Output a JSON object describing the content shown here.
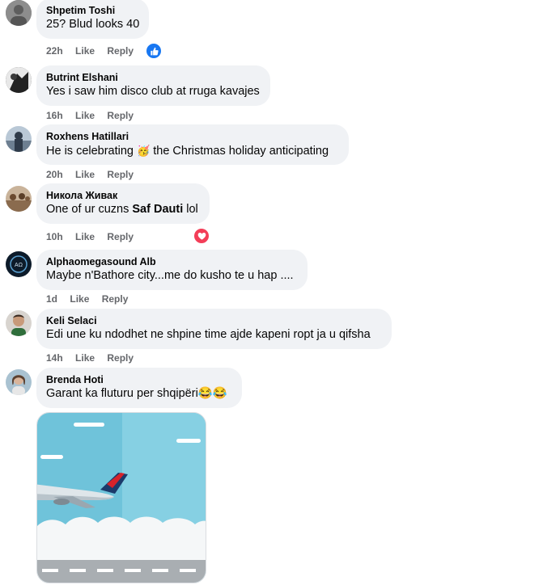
{
  "comments": [
    {
      "author": "Shpetim Toshi",
      "text": "25? Blud looks 40",
      "time": "22h",
      "like": "Like",
      "reply": "Reply",
      "reaction": "like-icon",
      "avatar_color": "#7a7a7a"
    },
    {
      "author": "Butrint Elshani",
      "text": "Yes i saw him disco club at rruga kavajes",
      "time": "16h",
      "like": "Like",
      "reply": "Reply",
      "avatar_color": "#2d2d2d"
    },
    {
      "author": "Roxhens Hatillari",
      "text_before": "He is celebrating",
      "emoji": "🥳",
      "text_after": "the Christmas holiday anticipating",
      "time": "20h",
      "like": "Like",
      "reply": "Reply",
      "avatar_color": "#4a6785"
    },
    {
      "author": "Никола Живак",
      "text_before": "One of ur cuzns",
      "bold": "Saf Dauti",
      "text_after": "lol",
      "time": "10h",
      "like": "Like",
      "reply": "Reply",
      "reaction": "heart-icon",
      "avatar_color": "#8a6b4e"
    },
    {
      "author": "Alphaomegasound Alb",
      "text": "Maybe n'Bathore city...me do kusho te u hap ....",
      "time": "1d",
      "like": "Like",
      "reply": "Reply",
      "avatar_color": "#0d1b2a"
    },
    {
      "author": "Keli Selaci",
      "text": "Edi une ku ndodhet ne shpine time ajde kapeni ropt ja u qifsha",
      "time": "14h",
      "like": "Like",
      "reply": "Reply",
      "avatar_color": "#6b4a3a"
    },
    {
      "author": "Brenda Hoti",
      "text": "Garant ka fluturu per shqipëri😂😂",
      "time": "",
      "like": "",
      "reply": "",
      "avatar_color": "#5d7a8c"
    }
  ],
  "colors": {
    "like_blue": "#1877f2",
    "heart_red": "#f33e58",
    "bubble": "#f0f2f5",
    "meta": "#65676b"
  },
  "image": {
    "subject": "airplane-illustration"
  }
}
